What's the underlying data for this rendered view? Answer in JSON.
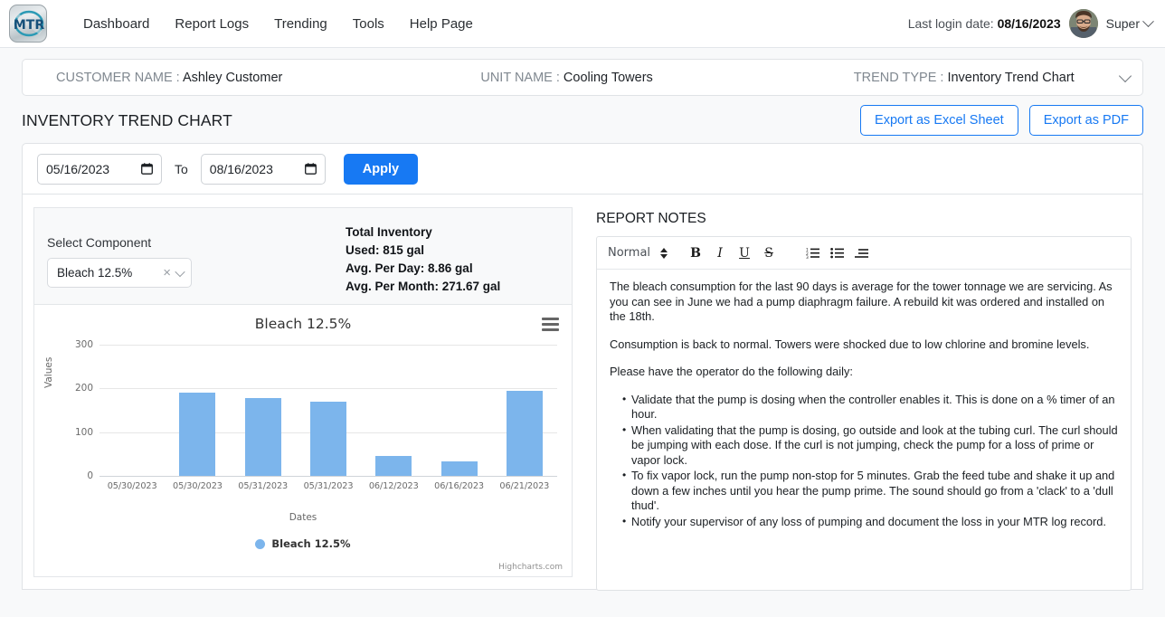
{
  "nav": {
    "logo_text": "MTR",
    "links": [
      "Dashboard",
      "Report Logs",
      "Trending",
      "Tools",
      "Help Page"
    ],
    "last_login_label": "Last login date:",
    "last_login_date": "08/16/2023",
    "user_name": "Super"
  },
  "info_bar": {
    "customer_label": "CUSTOMER NAME :",
    "customer_value": "Ashley Customer",
    "unit_label": "UNIT NAME :",
    "unit_value": "Cooling Towers",
    "trend_label": "TREND TYPE :",
    "trend_value": "Inventory Trend Chart"
  },
  "header": {
    "title": "INVENTORY TREND CHART",
    "export_excel": "Export as Excel Sheet",
    "export_pdf": "Export as PDF"
  },
  "filter": {
    "from_date": "05/16/2023",
    "to_label": "To",
    "to_date": "08/16/2023",
    "apply_label": "Apply"
  },
  "component": {
    "select_label": "Select Component",
    "selected": "Bleach 12.5%",
    "clear_glyph": "×"
  },
  "stats": {
    "total_inventory": "Total Inventory Used: 815 gal",
    "avg_per_day": "Avg. Per Day: 8.86 gal",
    "avg_per_month": "Avg. Per Month: 271.67 gal"
  },
  "chart_data": {
    "type": "bar",
    "title": "Bleach 12.5%",
    "xlabel": "Dates",
    "ylabel": "Values",
    "categories": [
      "05/30/2023",
      "05/30/2023",
      "05/31/2023",
      "05/31/2023",
      "06/12/2023",
      "06/16/2023",
      "06/21/2023"
    ],
    "values": [
      0,
      190,
      178,
      170,
      45,
      33,
      195
    ],
    "series": [
      {
        "name": "Bleach 12.5%",
        "values": [
          0,
          190,
          178,
          170,
          45,
          33,
          195
        ],
        "color": "#7cb5ec"
      }
    ],
    "yticks": [
      0,
      100,
      200,
      300
    ],
    "ylim": [
      0,
      300
    ],
    "grid": true,
    "legend": [
      "Bleach 12.5%"
    ],
    "legend_position": "bottom",
    "credits": "Highcharts.com",
    "context_menu": "hamburger-menu"
  },
  "notes": {
    "title": "REPORT NOTES",
    "toolbar": {
      "format": "Normal",
      "bold": "B",
      "italic": "I",
      "underline": "U",
      "strike": "S"
    },
    "paragraphs": [
      "The bleach consumption for the last 90 days is average for the tower tonnage we are servicing. As you can see in June we had a pump diaphragm failure. A rebuild kit was ordered and installed on the 18th.",
      "Consumption is back to normal. Towers were shocked due to low chlorine and bromine levels.",
      "Please have the operator do the following daily:"
    ],
    "bullets": [
      "Validate that the pump is dosing when the controller enables it. This is done on a % timer of an hour.",
      "When validating that the pump is dosing, go outside and look at the tubing curl. The curl should be jumping with each dose. If the curl is not jumping, check the pump for a loss of prime or vapor lock.",
      "To fix vapor lock, run the pump non-stop for 5 minutes. Grab the feed tube and shake it up and down a few inches until you hear the pump prime. The sound should go from a 'clack' to a 'dull thud'.",
      "Notify your supervisor of any loss of pumping and document the loss in your MTR log record."
    ]
  },
  "colors": {
    "accent": "#1779f3",
    "bar": "#7cb5ec",
    "page_bg": "#f8f9fa"
  }
}
